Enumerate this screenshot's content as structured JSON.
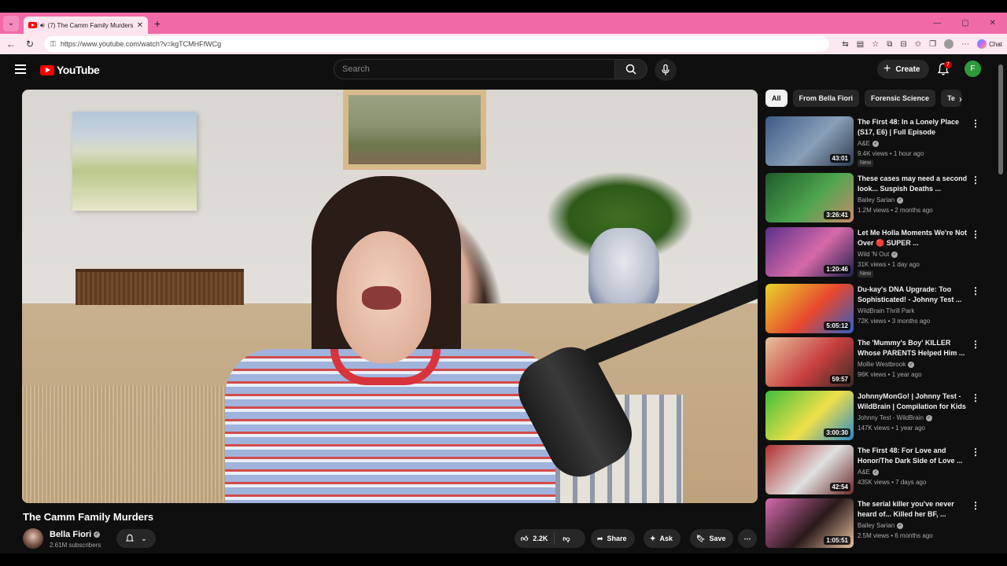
{
  "browser": {
    "tab_title": "(7) The Camm Family Murders",
    "url": "https://www.youtube.com/watch?v=kgTCMHFfWCg",
    "chat_label": "Chat"
  },
  "youtube": {
    "logo_text": "YouTube",
    "search_placeholder": "Search",
    "create_label": "Create",
    "notification_count": "7",
    "user_initial": "F"
  },
  "video": {
    "title": "The Camm Family Murders",
    "channel": "Bella Fiori",
    "subscribers": "2.61M subscribers",
    "likes": "2.2K",
    "share_label": "Share",
    "ask_label": "Ask",
    "save_label": "Save"
  },
  "chips": [
    "All",
    "From Bella Fiori",
    "Forensic Science",
    "Te"
  ],
  "recommendations": [
    {
      "title": "The First 48: In a Lonely Place (S17, E6) | Full Episode",
      "channel": "A&E",
      "verified": true,
      "meta": "9.4K views • 1 hour ago",
      "duration": "43:01",
      "new": true,
      "thumb": [
        "#3b5a86",
        "#8aa0b8",
        "#2c3b4f"
      ]
    },
    {
      "title": "These cases may need a second look... Suspish Deaths ...",
      "channel": "Bailey Sarian",
      "verified": true,
      "meta": "1.2M views • 2 months ago",
      "duration": "3:26:41",
      "new": false,
      "thumb": [
        "#1e5a2a",
        "#4ea64f",
        "#c98a6a"
      ]
    },
    {
      "title": "Let Me Holla Moments We're Not Over 🔴 SUPER ...",
      "channel": "Wild 'N Out",
      "verified": true,
      "meta": "31K views • 1 day ago",
      "duration": "1:20:46",
      "new": true,
      "thumb": [
        "#5b2f8a",
        "#d66aa8",
        "#20204a"
      ]
    },
    {
      "title": "Du-kay's DNA Upgrade: Too Sophisticated! - Johnny Test ...",
      "channel": "WildBrain Thrill Park",
      "verified": false,
      "meta": "72K views • 3 months ago",
      "duration": "5:05:12",
      "new": false,
      "thumb": [
        "#e8d42a",
        "#e6482f",
        "#2f5fc4"
      ]
    },
    {
      "title": "The 'Mummy's Boy' KILLER Whose PARENTS Helped Him ...",
      "channel": "Mollie Westbrook",
      "verified": true,
      "meta": "96K views • 1 year ago",
      "duration": "59:57",
      "new": false,
      "thumb": [
        "#e6c39a",
        "#c84040",
        "#3a2a24"
      ]
    },
    {
      "title": "JohnnyMonGo! | Johnny Test - WildBrain | Compilation for Kids",
      "channel": "Johnny Test - WildBrain",
      "verified": true,
      "meta": "147K views • 1 year ago",
      "duration": "3:00:30",
      "new": false,
      "thumb": [
        "#3fbf3a",
        "#f0e04a",
        "#2a8ac8"
      ]
    },
    {
      "title": "The First 48: For Love and Honor/The Dark Side of Love ...",
      "channel": "A&E",
      "verified": true,
      "meta": "435K views • 7 days ago",
      "duration": "42:54",
      "new": false,
      "thumb": [
        "#b03030",
        "#e0e0e0",
        "#6a2a2a"
      ]
    },
    {
      "title": "The serial killer you've never heard of... Killed her BF, ...",
      "channel": "Bailey Sarian",
      "verified": true,
      "meta": "2.5M views • 6 months ago",
      "duration": "1:05:51",
      "new": false,
      "thumb": [
        "#d66ab0",
        "#2a1a1a",
        "#e8c0a0"
      ]
    }
  ]
}
